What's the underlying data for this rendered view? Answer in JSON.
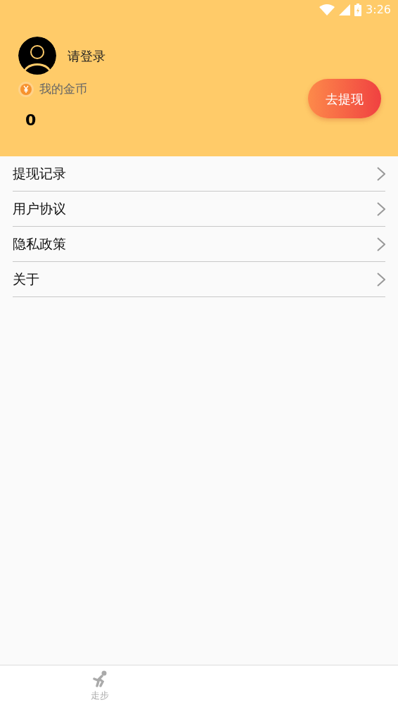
{
  "status_bar": {
    "time": "3:26"
  },
  "profile": {
    "login_prompt": "请登录",
    "coins_label": "我的金币",
    "coins": "0",
    "withdraw_button": "去提现"
  },
  "menu": [
    {
      "label": "提现记录"
    },
    {
      "label": "用户协议"
    },
    {
      "label": "隐私政策"
    },
    {
      "label": "关于"
    }
  ],
  "tab_bar": [
    {
      "label": "走步",
      "selected": false
    }
  ]
}
